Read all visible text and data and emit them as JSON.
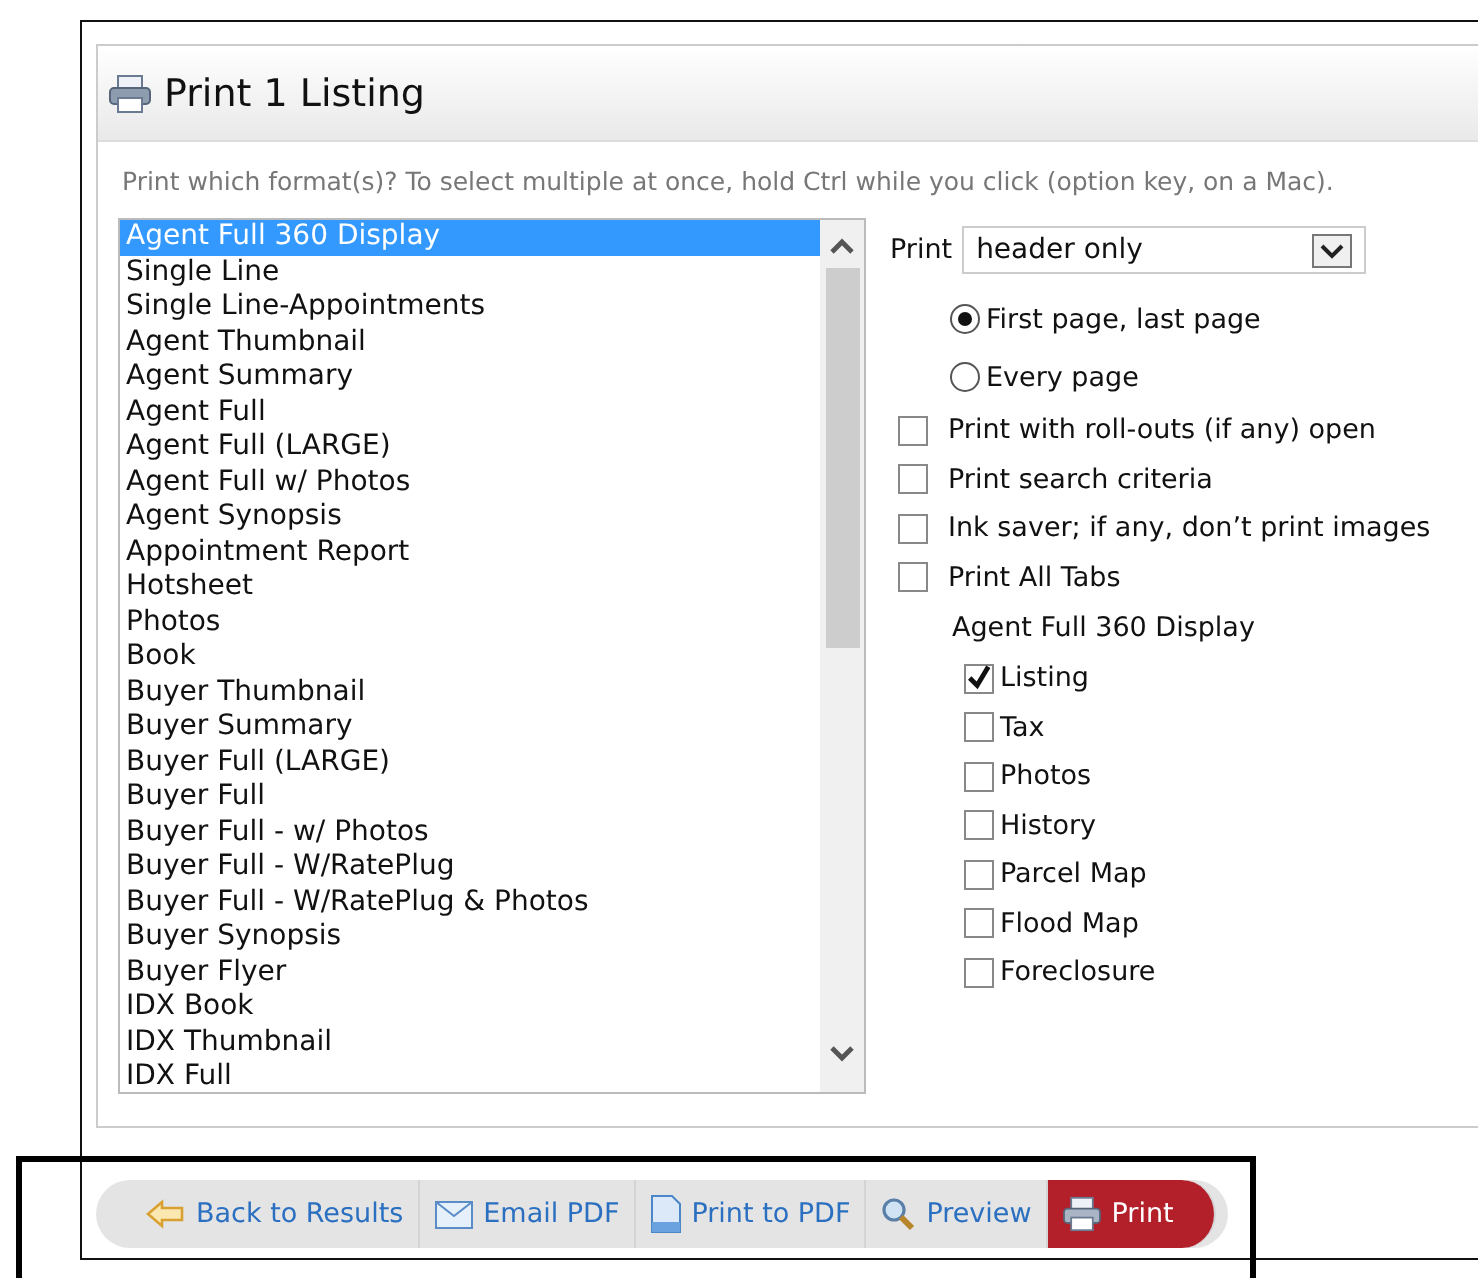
{
  "dialog": {
    "title": "Print 1 Listing"
  },
  "instructions": "Print which format(s)? To select multiple at once, hold Ctrl while you click (option key, on a Mac).",
  "formats": [
    {
      "label": "Agent Full 360 Display",
      "selected": true
    },
    {
      "label": "Single Line",
      "selected": false
    },
    {
      "label": "Single Line-Appointments",
      "selected": false
    },
    {
      "label": "Agent Thumbnail",
      "selected": false
    },
    {
      "label": "Agent Summary",
      "selected": false
    },
    {
      "label": "Agent Full",
      "selected": false
    },
    {
      "label": "Agent Full (LARGE)",
      "selected": false
    },
    {
      "label": "Agent Full w/ Photos",
      "selected": false
    },
    {
      "label": "Agent Synopsis",
      "selected": false
    },
    {
      "label": "Appointment Report",
      "selected": false
    },
    {
      "label": "Hotsheet",
      "selected": false
    },
    {
      "label": "Photos",
      "selected": false
    },
    {
      "label": "Book",
      "selected": false
    },
    {
      "label": "Buyer Thumbnail",
      "selected": false
    },
    {
      "label": "Buyer Summary",
      "selected": false
    },
    {
      "label": "Buyer Full (LARGE)",
      "selected": false
    },
    {
      "label": "Buyer Full",
      "selected": false
    },
    {
      "label": "Buyer Full - w/ Photos",
      "selected": false
    },
    {
      "label": "Buyer Full - W/RatePlug",
      "selected": false
    },
    {
      "label": "Buyer Full - W/RatePlug & Photos",
      "selected": false
    },
    {
      "label": "Buyer Synopsis",
      "selected": false
    },
    {
      "label": "Buyer Flyer",
      "selected": false
    },
    {
      "label": "IDX Book",
      "selected": false
    },
    {
      "label": "IDX Thumbnail",
      "selected": false
    },
    {
      "label": "IDX Full",
      "selected": false
    }
  ],
  "print_option": {
    "label": "Print",
    "value": "header only"
  },
  "page_options": [
    {
      "label": "First page, last page",
      "selected": true
    },
    {
      "label": "Every page",
      "selected": false
    }
  ],
  "options": [
    {
      "label": "Print with roll-outs (if any) open",
      "checked": false
    },
    {
      "label": "Print search criteria",
      "checked": false
    },
    {
      "label": "Ink saver; if any, don’t print images",
      "checked": false
    },
    {
      "label": "Print All Tabs",
      "checked": false
    }
  ],
  "section_title": "Agent Full 360 Display",
  "sections": [
    {
      "label": "Listing",
      "checked": true
    },
    {
      "label": "Tax",
      "checked": false
    },
    {
      "label": "Photos",
      "checked": false
    },
    {
      "label": "History",
      "checked": false
    },
    {
      "label": "Parcel Map",
      "checked": false
    },
    {
      "label": "Flood Map",
      "checked": false
    },
    {
      "label": "Foreclosure",
      "checked": false
    }
  ],
  "toolbar": [
    {
      "label": "Back to Results",
      "kind": "back"
    },
    {
      "label": "Email PDF",
      "kind": "email"
    },
    {
      "label": "Print to PDF",
      "kind": "pdf"
    },
    {
      "label": "Preview",
      "kind": "preview"
    },
    {
      "label": "Print",
      "kind": "print"
    }
  ]
}
